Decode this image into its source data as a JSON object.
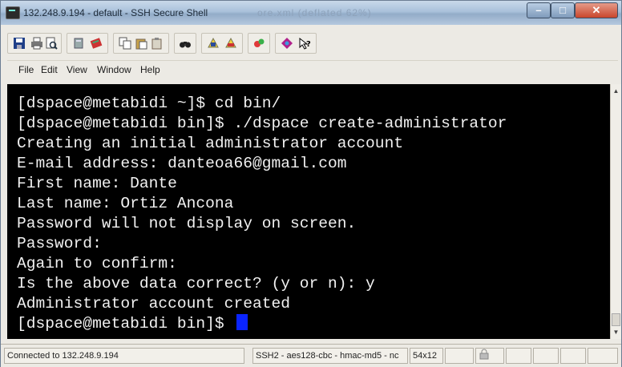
{
  "window": {
    "title": "132.248.9.194 - default - SSH Secure Shell",
    "ghost_title": "ore.xml (deflated 62%)"
  },
  "toolbar": {
    "icons": [
      "save-icon",
      "print-icon",
      "print-preview-icon",
      "quick-connect-icon",
      "profiles-icon",
      "copy-icon",
      "paste-icon",
      "paste-special-icon",
      "find-icon",
      "new-terminal-icon",
      "new-file-transfer-icon",
      "settings-icon",
      "help-topics-icon",
      "context-help-icon"
    ]
  },
  "menu": {
    "file": "File",
    "edit": "Edit",
    "view": "View",
    "window": "Window",
    "help": "Help"
  },
  "terminal": {
    "lines": [
      "[dspace@metabidi ~]$ cd bin/",
      "[dspace@metabidi bin]$ ./dspace create-administrator",
      "Creating an initial administrator account",
      "E-mail address: danteoa66@gmail.com",
      "First name: Dante",
      "Last name: Ortiz Ancona",
      "Password will not display on screen.",
      "Password:",
      "Again to confirm:",
      "Is the above data correct? (y or n): y",
      "Administrator account created",
      "[dspace@metabidi bin]$ "
    ],
    "background": "#000000",
    "foreground": "#f1f1f1",
    "cursor_color": "#0a24ff"
  },
  "status": {
    "connection": "Connected to 132.248.9.194",
    "cipher": "SSH2 - aes128-cbc - hmac-md5 - nc",
    "size": "54x12"
  }
}
